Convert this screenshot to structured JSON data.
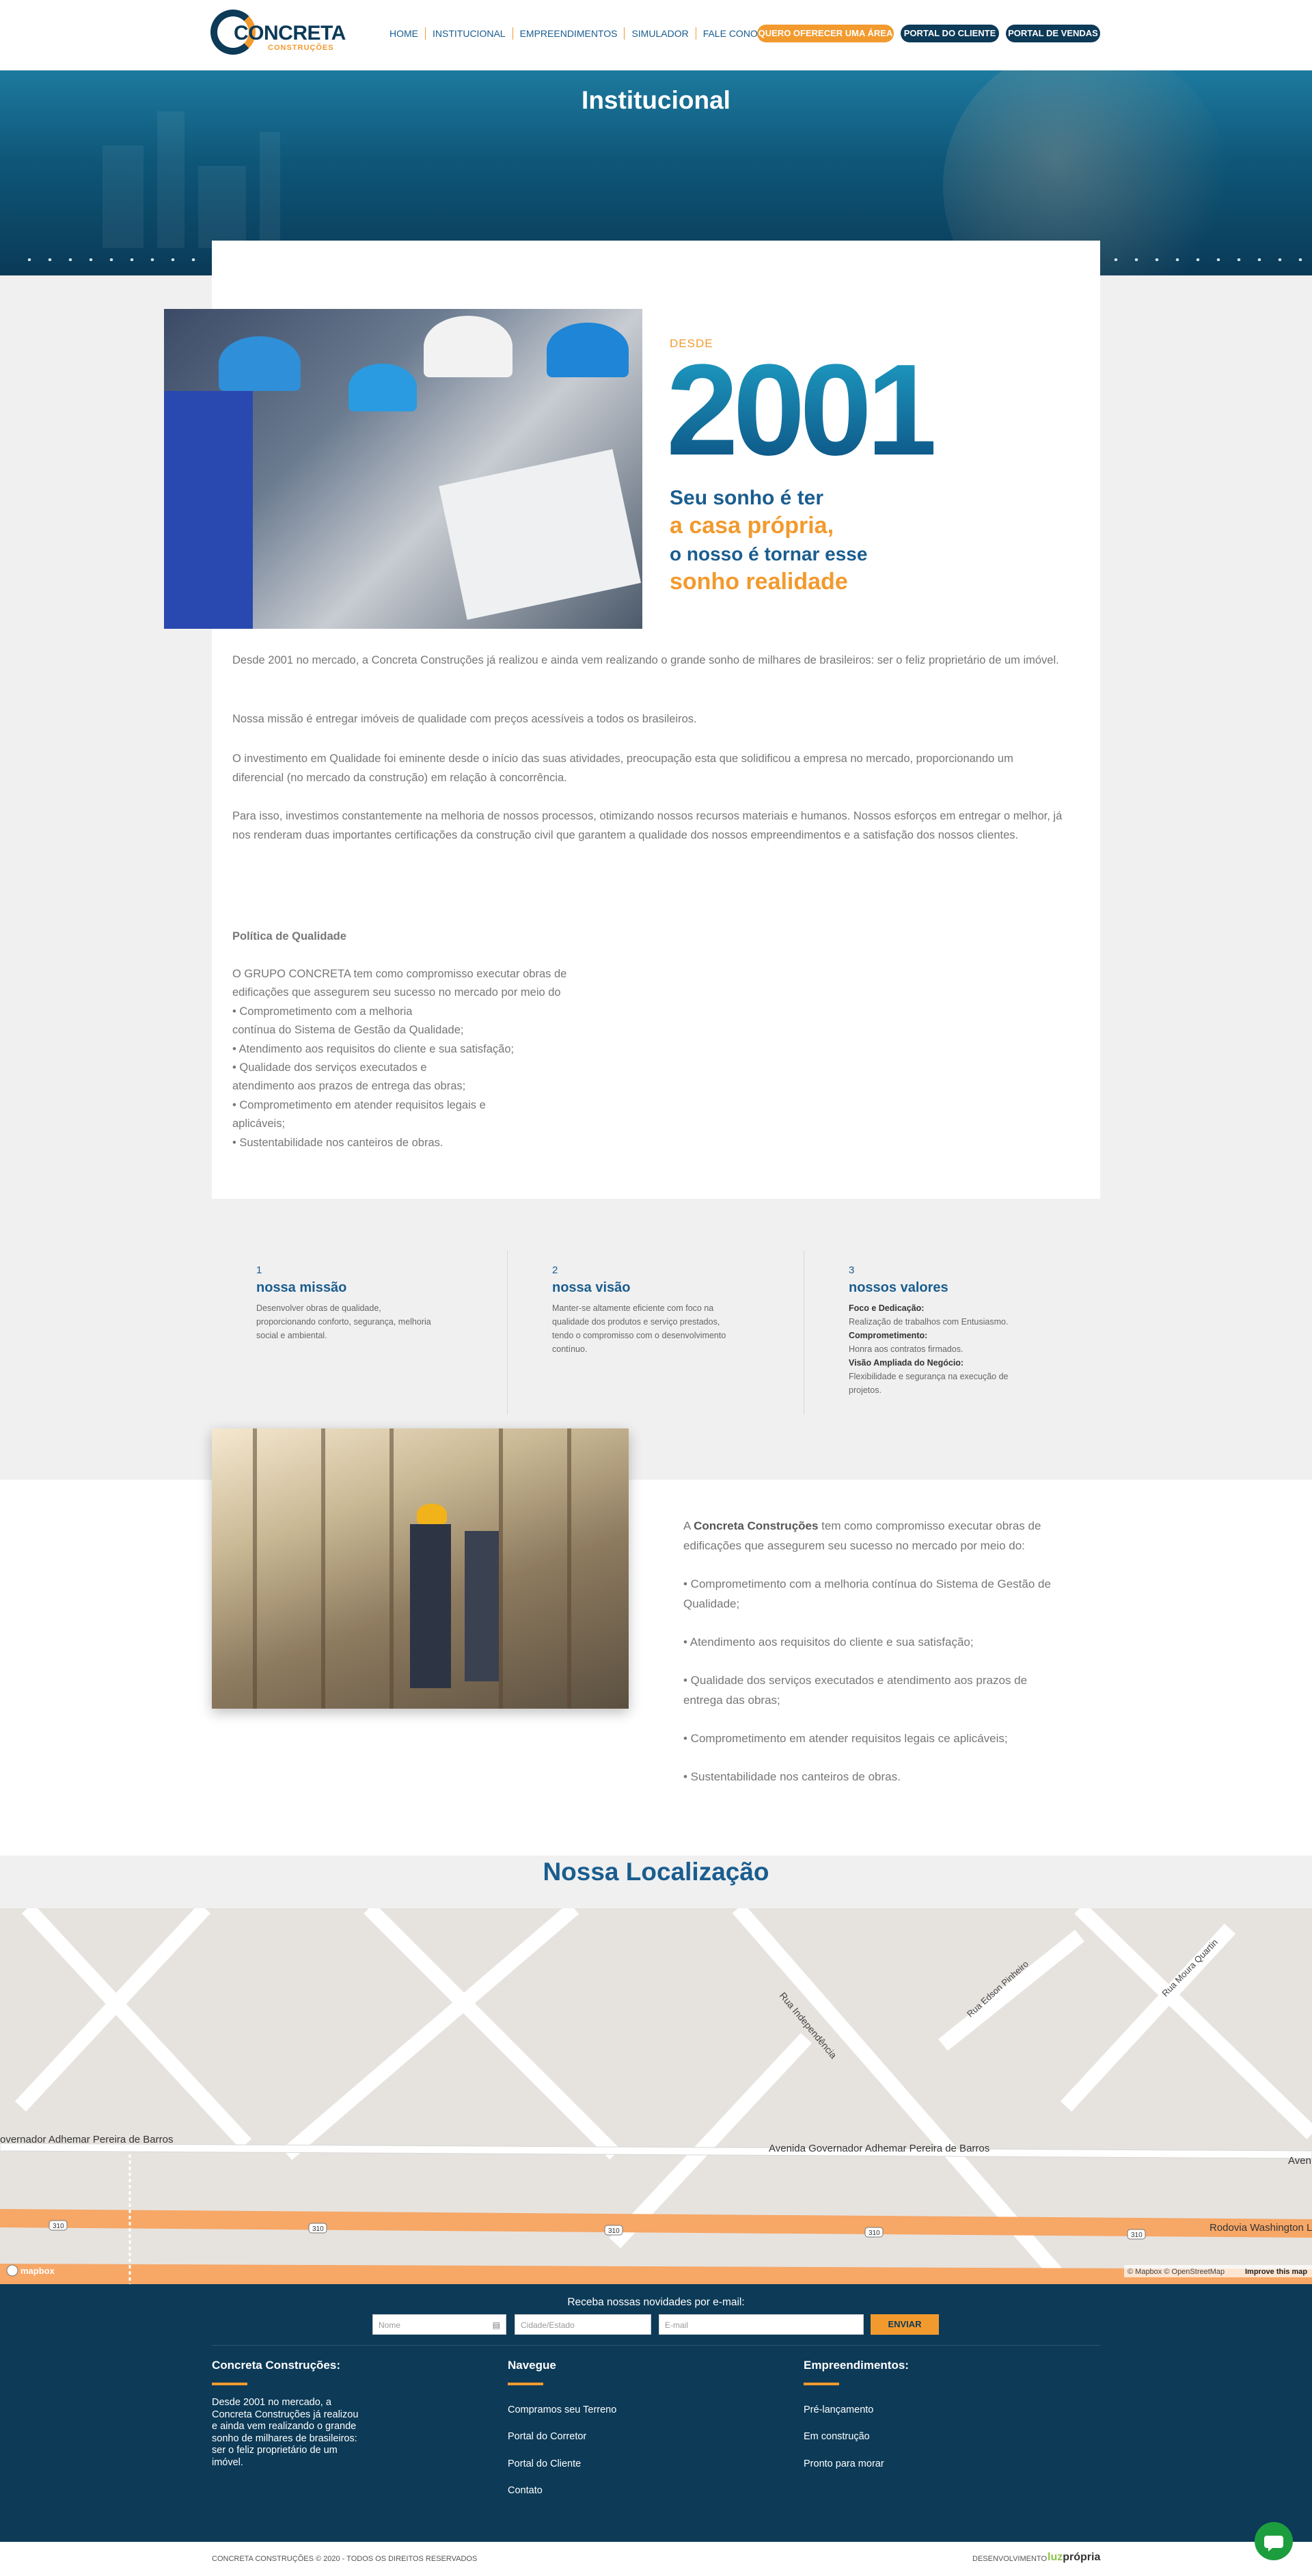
{
  "header": {
    "logo_name": "CONCRETA",
    "logo_sub": "CONSTRUÇÕES",
    "nav": [
      "HOME",
      "INSTITUCIONAL",
      "EMPREENDIMENTOS",
      "SIMULADOR",
      "FALE CONOSCO"
    ],
    "btn_offer": "QUERO OFERECER UMA ÁREA",
    "btn_client": "PORTAL DO CLIENTE",
    "btn_sales": "PORTAL DE VENDAS"
  },
  "hero": {
    "title": "Institucional"
  },
  "intro": {
    "desde": "DESDE",
    "year": "2001",
    "slogan1": "Seu sonho é ter",
    "slogan2": "a casa própria,",
    "slogan3": "o nosso é tornar esse",
    "slogan4": "sonho realidade",
    "p1": "Desde 2001 no mercado, a Concreta Construções já realizou e ainda vem realizando o grande sonho de milhares de brasileiros: ser o feliz proprietário de um imóvel.",
    "p2": "Nossa missão é entregar imóveis de qualidade com preços acessíveis a todos os brasileiros.",
    "p3": "O investimento em Qualidade foi eminente desde o início das suas atividades, preocupação esta que solidificou a empresa no mercado, proporcionando um diferencial (no mercado da construção) em relação à concorrência.",
    "p4": "Para isso, investimos constantemente na melhoria de nossos processos, otimizando nossos recursos materiais e humanos. Nossos esforços em entregar o melhor, já nos renderam duas importantes certificações da construção civil que garantem a qualidade dos nossos empreendimentos e a satisfação dos nossos clientes."
  },
  "policy": {
    "title": "Política de Qualidade",
    "lines": [
      "O GRUPO CONCRETA tem como compromisso executar obras de",
      "edificações que assegurem seu sucesso no mercado por meio do",
      "•    Comprometimento com a melhoria",
      "contínua do Sistema de Gestão da Qualidade;",
      "•    Atendimento aos requisitos do cliente e sua satisfação;",
      "•    Qualidade dos serviços executados e",
      "atendimento aos prazos de entrega das obras;",
      "•    Comprometimento em atender requisitos legais e",
      "aplicáveis;",
      "•    Sustentabilidade nos canteiros de obras."
    ]
  },
  "values": [
    {
      "num": "1",
      "title": "nossa missão",
      "lines": [
        "Desenvolver obras de qualidade,",
        "proporcionando conforto, segurança, melhoria",
        "social e ambiental."
      ]
    },
    {
      "num": "2",
      "title": "nossa visão",
      "lines": [
        "Manter-se altamente eficiente com foco na",
        "qualidade dos produtos e serviço prestados,",
        "tendo o compromisso com o desenvolvimento",
        "contínuo."
      ]
    },
    {
      "num": "3",
      "title": "nossos valores",
      "lines": [
        "Foco e Dedicação:",
        "Realização de trabalhos com Entusiasmo.",
        "Comprometimento:",
        "Honra aos contratos firmados.",
        "Visão Ampliada do  Negócio:",
        "Flexibilidade e segurança na execução de",
        "projetos."
      ]
    }
  ],
  "commitment": {
    "lead_a": "A ",
    "lead_b": "Concreta Construções",
    "lead_c": "  tem como compromisso executar obras de edificações que assegurem seu sucesso no mercado por meio do:",
    "items": [
      "• Comprometimento com a melhoria contínua do Sistema de Gestão de Qualidade;",
      "• Atendimento aos requisitos do cliente e sua satisfação;",
      "• Qualidade dos serviços executados e atendimento aos prazos de entrega das obras;",
      "• Comprometimento em atender requisitos legais ce aplicáveis;",
      "• Sustentabilidade nos canteiros de obras."
    ]
  },
  "location": {
    "title": "Nossa Localização",
    "streets": [
      "Rua Independência",
      "Rua Edson Pinheiro",
      "Rua Moura Quartin",
      "Avenida Governador Adhemar Pereira de Barros",
      "overnador Adhemar Pereira de Barros",
      "Rodovia Washington L",
      "Aven"
    ],
    "shields": [
      "310",
      "310",
      "310",
      "310",
      "310"
    ],
    "mapbox": "mapbox",
    "attribution": "© Mapbox © OpenStreetMap",
    "improve": "Improve this map"
  },
  "newsletter": {
    "label": "Receba nossas novidades por e-mail:",
    "name_ph": "Nome",
    "city_ph": "Cidade/Estado",
    "email_ph": "E-mail",
    "send": "ENVIAR"
  },
  "footer": {
    "col1_title": "Concreta Construções:",
    "col1_lines": [
      "Desde 2001 no mercado, a",
      "Concreta Construções já realizou",
      "e ainda vem realizando o grande",
      "sonho de milhares de brasileiros:",
      "ser o feliz proprietário de um",
      "imóvel."
    ],
    "col2_title": "Navegue",
    "col2_links": [
      "Compramos seu Terreno",
      "Portal do Corretor",
      "Portal do Cliente",
      "Contato"
    ],
    "col3_title": "Empreendimentos:",
    "col3_links": [
      "Pré-lançamento",
      "Em construção",
      "Pronto para morar"
    ],
    "copyright": "CONCRETA CONSTRUÇÕES © 2020 - TODOS OS DIREITOS RESERVADOS",
    "dev_label": "DESENVOLVIMENTO",
    "dev_a": "luz",
    "dev_b": "própria"
  },
  "colors": {
    "navy": "#0c3a57",
    "blue": "#1a5d8f",
    "orange": "#f29a2e",
    "chat": "#1d9e3e"
  }
}
